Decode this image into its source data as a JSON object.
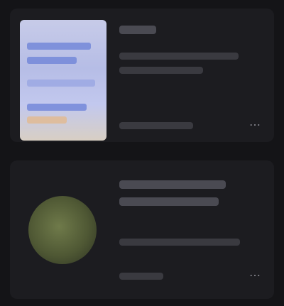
{
  "items": [
    {
      "title": "",
      "subtitle": "",
      "meta": "",
      "more": "⋯"
    },
    {
      "title": "",
      "subtitle": "",
      "meta": "",
      "more": "⋯"
    }
  ]
}
